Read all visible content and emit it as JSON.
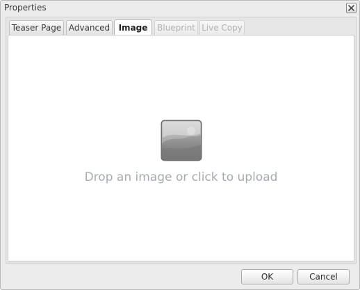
{
  "dialog": {
    "title": "Properties",
    "close_icon": "close-icon"
  },
  "tabs": [
    {
      "label": "Teaser Page",
      "state": "normal"
    },
    {
      "label": "Advanced",
      "state": "normal"
    },
    {
      "label": "Image",
      "state": "active"
    },
    {
      "label": "Blueprint",
      "state": "disabled"
    },
    {
      "label": "Live Copy",
      "state": "disabled"
    }
  ],
  "upload": {
    "icon": "image-placeholder-icon",
    "text": "Drop an image or click to upload"
  },
  "buttons": {
    "ok_label": "OK",
    "cancel_label": "Cancel"
  }
}
